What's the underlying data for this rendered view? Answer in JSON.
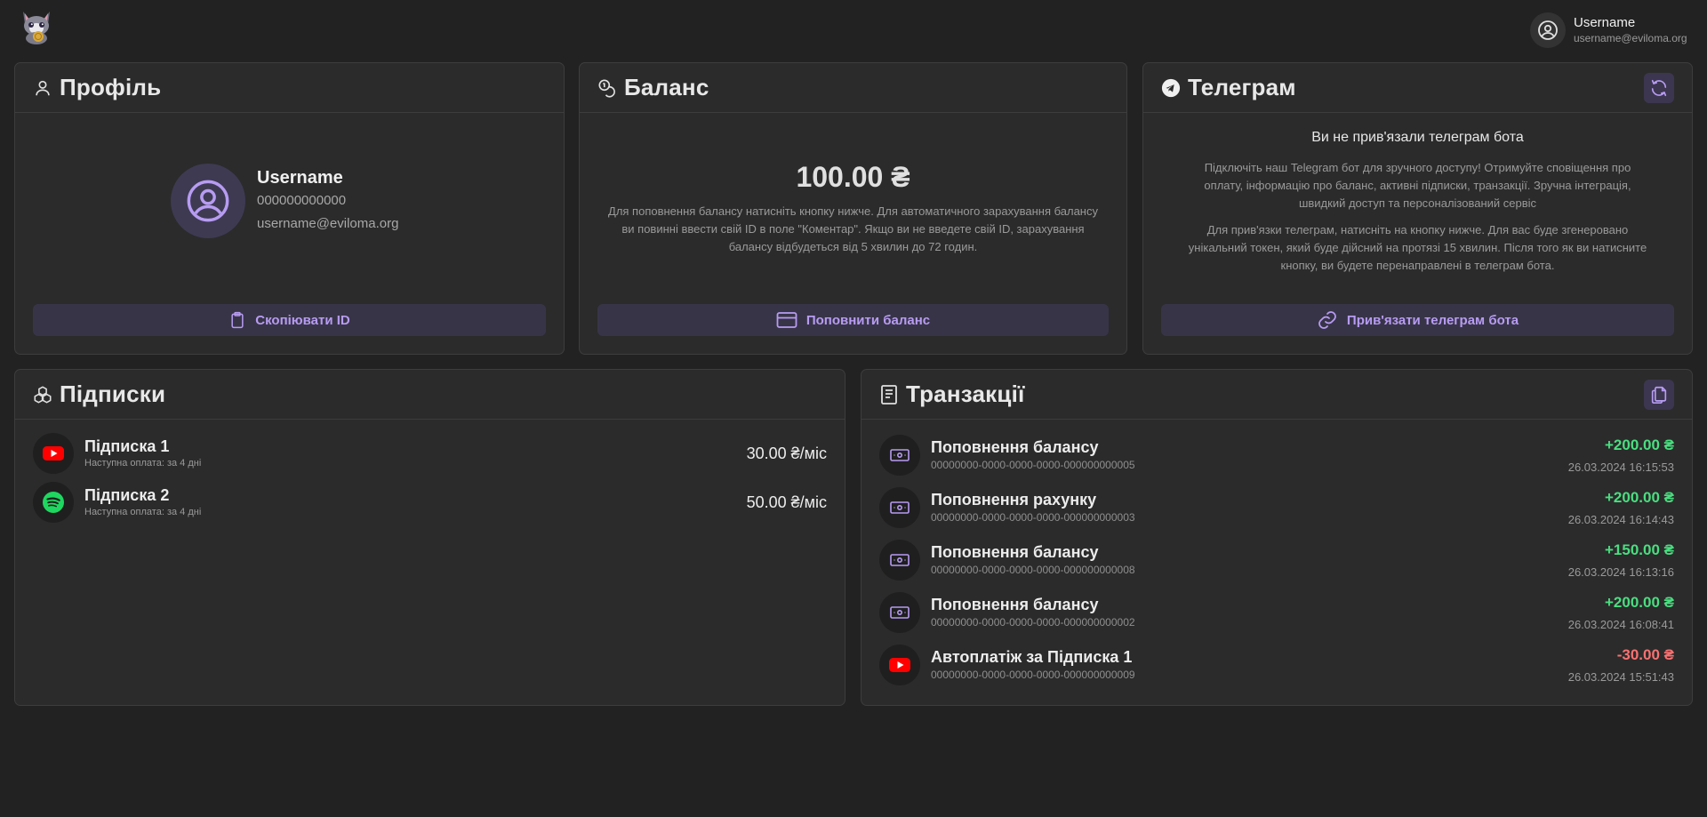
{
  "header": {
    "user_name": "Username",
    "user_email": "username@eviloma.org"
  },
  "profile": {
    "title": "Профіль",
    "name": "Username",
    "id": "000000000000",
    "email": "username@eviloma.org",
    "copy_button": "Скопіювати ID"
  },
  "balance": {
    "title": "Баланс",
    "amount": "100.00 ₴",
    "description": "Для поповнення балансу натисніть кнопку нижче. Для автоматичного зарахування балансу ви повинні ввести свій ID в поле \"Коментар\". Якщо ви не введете свій ID, зарахування балансу відбудеться від 5 хвилин до 72 годин.",
    "topup_button": "Поповнити баланс"
  },
  "telegram": {
    "title": "Телеграм",
    "status": "Ви не прив'язали телеграм бота",
    "paragraph1": "Підключіть наш Telegram бот для зручного доступу! Отримуйте сповіщення про оплату, інформацію про баланс, активні підписки, транзакції. Зручна інтеграція, швидкий доступ та персоналізований сервіс",
    "paragraph2": "Для прив'язки телеграм, натисніть на кнопку нижче. Для вас буде згенеровано унікальний токен, який буде дійсний на протязі 15 хвилин. Після того як ви натисните кнопку, ви будете перенаправлені в телеграм бота.",
    "link_button": "Прив'язати телеграм бота"
  },
  "subscriptions": {
    "title": "Підписки",
    "items": [
      {
        "name": "Підписка 1",
        "next": "Наступна оплата: за 4 дні",
        "price": "30.00 ₴/міс",
        "icon": "youtube-icon"
      },
      {
        "name": "Підписка 2",
        "next": "Наступна оплата: за 4 дні",
        "price": "50.00 ₴/міс",
        "icon": "spotify-icon"
      }
    ]
  },
  "transactions": {
    "title": "Транзакції",
    "items": [
      {
        "name": "Поповнення балансу",
        "id": "00000000-0000-0000-0000-000000000005",
        "amount": "+200.00 ₴",
        "date": "26.03.2024 16:15:53",
        "type": "income",
        "icon": "cash-icon"
      },
      {
        "name": "Поповнення рахунку",
        "id": "00000000-0000-0000-0000-000000000003",
        "amount": "+200.00 ₴",
        "date": "26.03.2024 16:14:43",
        "type": "income",
        "icon": "cash-icon"
      },
      {
        "name": "Поповнення балансу",
        "id": "00000000-0000-0000-0000-000000000008",
        "amount": "+150.00 ₴",
        "date": "26.03.2024 16:13:16",
        "type": "income",
        "icon": "cash-icon"
      },
      {
        "name": "Поповнення балансу",
        "id": "00000000-0000-0000-0000-000000000002",
        "amount": "+200.00 ₴",
        "date": "26.03.2024 16:08:41",
        "type": "income",
        "icon": "cash-icon"
      },
      {
        "name": "Автоплатіж за Підписка 1",
        "id": "00000000-0000-0000-0000-000000000009",
        "amount": "-30.00 ₴",
        "date": "26.03.2024 15:51:43",
        "type": "expense",
        "icon": "youtube-icon"
      }
    ]
  },
  "colors": {
    "accent": "#b79cf2",
    "income": "#4ade80",
    "expense": "#f87171",
    "background": "#222222",
    "card": "#2b2b2b"
  }
}
